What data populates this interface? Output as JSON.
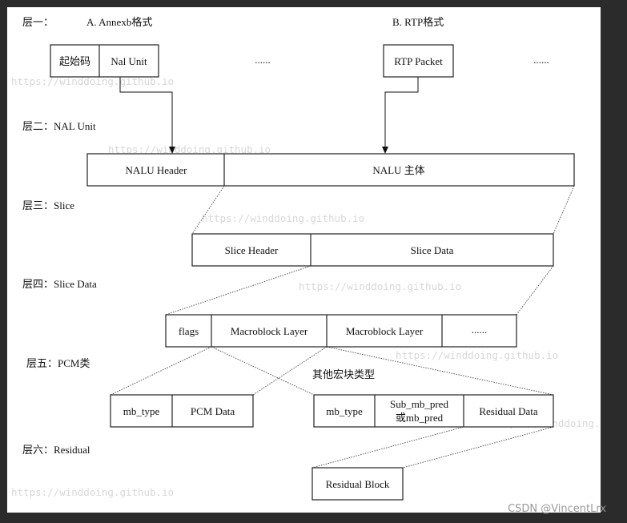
{
  "layers": {
    "l1": "层一：",
    "l1_a": "A. Annexb格式",
    "l1_b": "B. RTP格式",
    "l2": "层二：NAL Unit",
    "l3": "层三：Slice",
    "l4": "层四：Slice Data",
    "l5": "层五：PCM类",
    "l6": "层六：Residual"
  },
  "boxes": {
    "start_code": "起始码",
    "nal_unit": "Nal Unit",
    "ellipsis": "......",
    "rtp_packet": "RTP Packet",
    "nalu_header": "NALU Header",
    "nalu_body": "NALU 主体",
    "slice_header": "Slice Header",
    "slice_data": "Slice Data",
    "flags": "flags",
    "macroblock_layer": "Macroblock Layer",
    "mb_type": "mb_type",
    "pcm_data": "PCM Data",
    "sub_mb_pred_1": "Sub_mb_pred",
    "sub_mb_pred_2": "或mb_pred",
    "residual_data": "Residual Data",
    "residual_block": "Residual Block",
    "other_mb_types": "其他宏块类型"
  },
  "watermark": "https://winddoing.github.io",
  "csdn_credit": "CSDN @VincentLrx"
}
